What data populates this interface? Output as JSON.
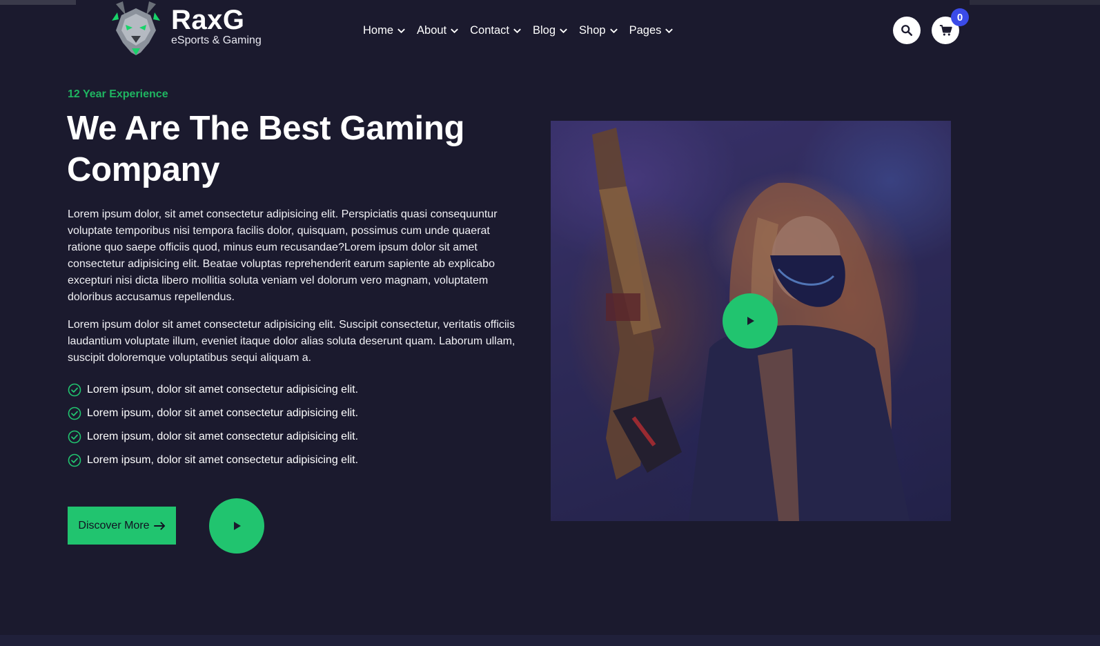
{
  "brand": {
    "name": "RaxG",
    "tagline": "eSports & Gaming"
  },
  "nav": [
    {
      "label": "Home"
    },
    {
      "label": "About"
    },
    {
      "label": "Contact"
    },
    {
      "label": "Blog"
    },
    {
      "label": "Shop"
    },
    {
      "label": "Pages"
    }
  ],
  "header": {
    "search_icon": "search-icon",
    "cart_icon": "cart-icon",
    "cart_count": "0"
  },
  "hero": {
    "eyebrow": "12 Year Experience",
    "title": "We Are The Best Gaming Company",
    "paragraph1": "Lorem ipsum dolor, sit amet consectetur adipisicing elit. Perspiciatis quasi consequuntur voluptate temporibus nisi tempora facilis dolor, quisquam, possimus cum unde quaerat ratione quo saepe officiis quod, minus eum recusandae?Lorem ipsum dolor sit amet consectetur adipisicing elit. Beatae voluptas reprehenderit earum sapiente ab explicabo excepturi nisi dicta libero mollitia soluta veniam vel dolorum vero magnam, voluptatem doloribus accusamus repellendus.",
    "paragraph2": "Lorem ipsum dolor sit amet consectetur adipisicing elit. Suscipit consectetur, veritatis officiis laudantium voluptate illum, eveniet itaque dolor alias soluta deserunt quam. Laborum ullam, suscipit doloremque voluptatibus sequi aliquam a.",
    "checklist": [
      "Lorem ipsum, dolor sit amet consectetur adipisicing elit.",
      "Lorem ipsum, dolor sit amet consectetur adipisicing elit.",
      "Lorem ipsum, dolor sit amet consectetur adipisicing elit.",
      "Lorem ipsum, dolor sit amet consectetur adipisicing elit."
    ],
    "cta_label": "Discover More"
  },
  "colors": {
    "background": "#1b1a2e",
    "accent": "#21c46f",
    "eyebrow": "#1fb561",
    "badge": "#3b4be8"
  }
}
